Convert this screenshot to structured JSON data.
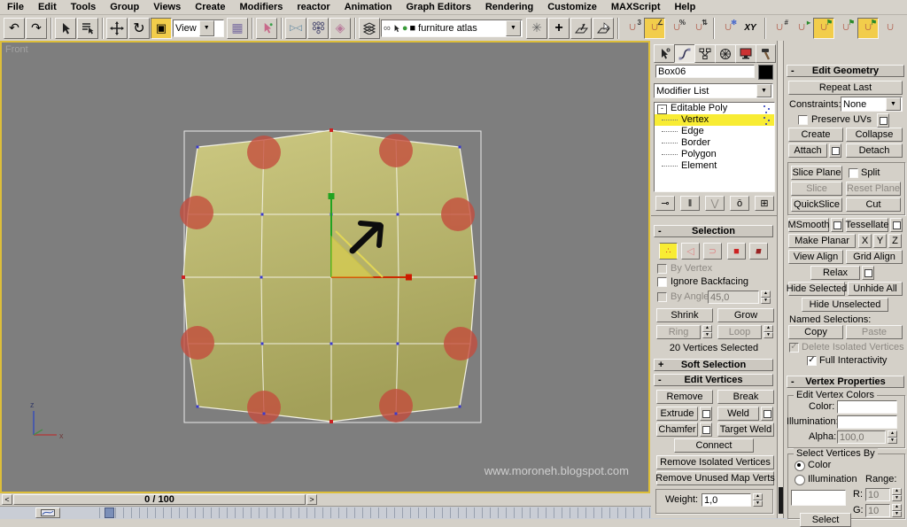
{
  "menu": {
    "items": [
      "File",
      "Edit",
      "Tools",
      "Group",
      "Views",
      "Create",
      "Modifiers",
      "reactor",
      "Animation",
      "Graph Editors",
      "Rendering",
      "Customize",
      "MAXScript",
      "Help"
    ]
  },
  "toolbar": {
    "coord_system": "View",
    "named_selection": "furniture atlas",
    "icons": {
      "undo": "↶",
      "redo": "↷",
      "select_by_name": "≡",
      "rotate": "↻",
      "move": "+",
      "scale": "▣",
      "use_center": "▦",
      "mirror": "▷◁",
      "array": "∷",
      "eraser": "◈",
      "layers": "≡",
      "glasses": "∞",
      "teapot": "●",
      "swatch": "■",
      "trackview": "✳",
      "align": "+",
      "flag": "⚑",
      "magnet": "∩",
      "dropdown": "▼",
      "snap_3": "3",
      "snap_angle": "∠",
      "snap_percent": "%",
      "snap_spinner": "⇅",
      "snap_frozen": "✻",
      "snap_xy": "XY",
      "snap_grid": "#",
      "snap_arrow": "▸"
    }
  },
  "viewport": {
    "label": "Front",
    "watermark": "www.moroneh.blogspot.com",
    "axis_x": "x",
    "axis_z": "z",
    "selected_vertex_count": 20,
    "colors": {
      "background": "#7e7e7e",
      "object_fill": "#bdb96c",
      "soft_red": "#c44b3c",
      "active_border": "#ddbe39"
    }
  },
  "timeline": {
    "prev": "<",
    "frame": "0 / 100",
    "next": ">"
  },
  "panel": {
    "object_name": "Box06",
    "modifier_list_label": "Modifier List",
    "stack": {
      "items": [
        "Editable Poly",
        "Vertex",
        "Edge",
        "Border",
        "Polygon",
        "Element"
      ],
      "selected": "Vertex"
    },
    "selection": {
      "title": "Selection",
      "collapse": "-",
      "by_vertex": "By Vertex",
      "ignore_backfacing": "Ignore Backfacing",
      "by_angle": "By Angle",
      "angle_value": "45,0",
      "shrink": "Shrink",
      "grow": "Grow",
      "ring": "Ring",
      "loop": "Loop",
      "status": "20 Vertices Selected"
    },
    "soft_selection": {
      "title": "Soft Selection",
      "expand": "+"
    },
    "edit_vertices": {
      "title": "Edit Vertices",
      "collapse": "-",
      "remove": "Remove",
      "break": "Break",
      "extrude": "Extrude",
      "weld": "Weld",
      "chamfer": "Chamfer",
      "target_weld": "Target Weld",
      "connect": "Connect",
      "remove_isolated": "Remove Isolated Vertices",
      "remove_unused": "Remove Unused Map Verts",
      "weight_label": "Weight:",
      "weight_value": "1,0"
    },
    "edit_geometry": {
      "title": "Edit Geometry",
      "collapse": "-",
      "repeat_last": "Repeat Last",
      "constraints_label": "Constraints:",
      "constraints_value": "None",
      "preserve_uvs": "Preserve UVs",
      "create": "Create",
      "collapse_btn": "Collapse",
      "attach": "Attach",
      "detach": "Detach",
      "slice_plane": "Slice Plane",
      "split": "Split",
      "slice": "Slice",
      "reset_plane": "Reset Plane",
      "quickslice": "QuickSlice",
      "cut": "Cut",
      "msmooth": "MSmooth",
      "tessellate": "Tessellate",
      "make_planar": "Make Planar",
      "x": "X",
      "y": "Y",
      "z": "Z",
      "view_align": "View Align",
      "grid_align": "Grid Align",
      "relax": "Relax",
      "hide_selected": "Hide Selected",
      "unhide_all": "Unhide All",
      "hide_unselected": "Hide Unselected",
      "named_selections": "Named Selections:",
      "copy": "Copy",
      "paste": "Paste",
      "delete_isolated": "Delete Isolated Vertices",
      "full_interactivity": "Full Interactivity"
    },
    "vertex_properties": {
      "title": "Vertex Properties",
      "collapse": "-",
      "group1": "Edit Vertex Colors",
      "color_label": "Color:",
      "illumination_label": "Illumination:",
      "alpha_label": "Alpha:",
      "alpha_value": "100,0",
      "group2": "Select Vertices By",
      "color_radio": "Color",
      "illumination_radio": "Illumination",
      "range_label": "Range:",
      "r_label": "R:",
      "r_value": "10",
      "g_label": "G:",
      "g_value": "10",
      "select": "Select"
    }
  }
}
